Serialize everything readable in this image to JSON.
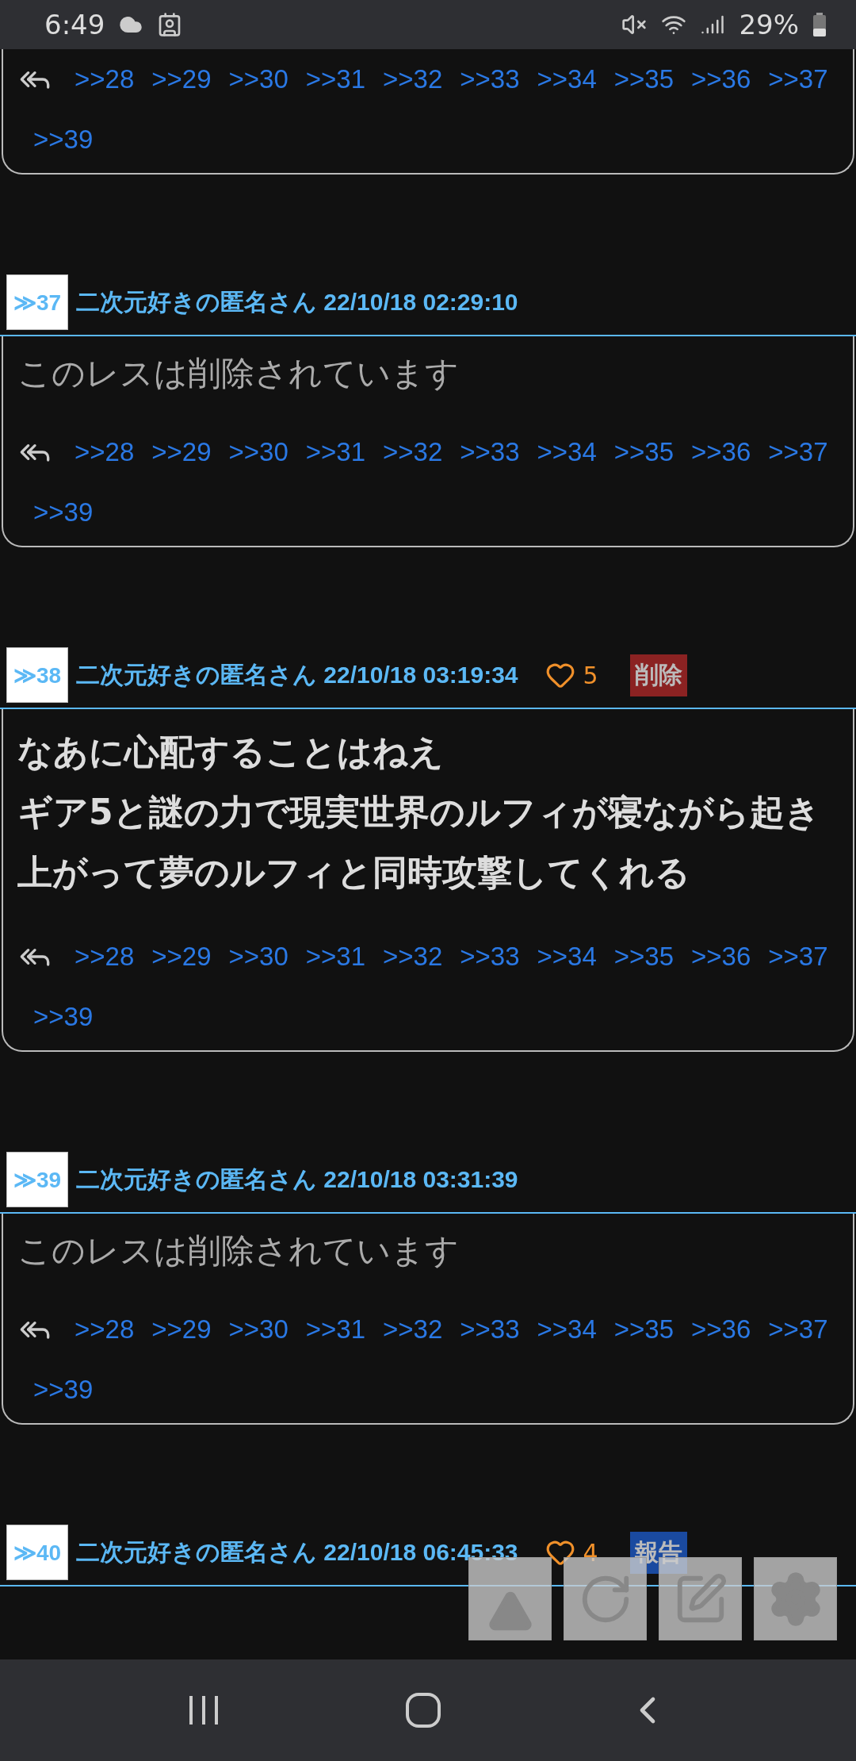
{
  "status_bar": {
    "time": "6:49",
    "battery": "29%"
  },
  "posts": [
    {
      "kind": "tail",
      "reply_links": [
        ">>28",
        ">>29",
        ">>30",
        ">>31",
        ">>32",
        ">>33",
        ">>34",
        ">>35",
        ">>36",
        ">>37",
        ">>39"
      ]
    },
    {
      "kind": "post",
      "number": "≫37",
      "author_date": "二次元好きの匿名さん 22/10/18 02:29:10",
      "deleted": true,
      "body": [
        "このレスは削除されています"
      ],
      "reply_links": [
        ">>28",
        ">>29",
        ">>30",
        ">>31",
        ">>32",
        ">>33",
        ">>34",
        ">>35",
        ">>36",
        ">>37",
        ">>39"
      ]
    },
    {
      "kind": "post",
      "number": "≫38",
      "author_date": "二次元好きの匿名さん 22/10/18 03:19:34",
      "likes": "5",
      "action": {
        "kind": "delete",
        "label": "削除"
      },
      "deleted": false,
      "body": [
        "なあに心配することはねえ",
        "ギア5と謎の力で現実世界のルフィが寝ながら起き上がって夢のルフィと同時攻撃してくれる"
      ],
      "reply_links": [
        ">>28",
        ">>29",
        ">>30",
        ">>31",
        ">>32",
        ">>33",
        ">>34",
        ">>35",
        ">>36",
        ">>37",
        ">>39"
      ]
    },
    {
      "kind": "post",
      "number": "≫39",
      "author_date": "二次元好きの匿名さん 22/10/18 03:31:39",
      "deleted": true,
      "body": [
        "このレスは削除されています"
      ],
      "reply_links": [
        ">>28",
        ">>29",
        ">>30",
        ">>31",
        ">>32",
        ">>33",
        ">>34",
        ">>35",
        ">>36",
        ">>37",
        ">>39"
      ]
    },
    {
      "kind": "post",
      "number": "≫40",
      "author_date": "二次元好きの匿名さん 22/10/18 06:45:33",
      "likes": "4",
      "action": {
        "kind": "report",
        "label": "報告"
      }
    }
  ]
}
